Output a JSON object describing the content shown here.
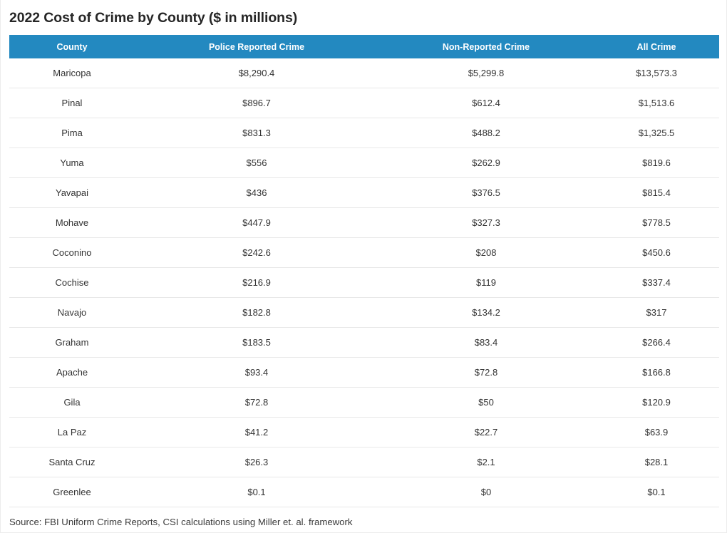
{
  "header": {
    "title": "2022 Cost of Crime by County ($ in millions)"
  },
  "colors": {
    "header_band": "#2389c0",
    "header_text": "#ffffff",
    "title_text": "#262626",
    "cell_text": "#333333",
    "row_divider": "#e8e8e8",
    "page_background": "#ffffff"
  },
  "table": {
    "columns": [
      {
        "key": "county",
        "label": "County",
        "align": "center"
      },
      {
        "key": "police_reported",
        "label": "Police Reported Crime",
        "align": "center"
      },
      {
        "key": "non_reported",
        "label": "Non-Reported Crime",
        "align": "center"
      },
      {
        "key": "all_crime",
        "label": "All Crime",
        "align": "center"
      }
    ],
    "rows": [
      {
        "county": "Maricopa",
        "police_reported": "$8,290.4",
        "non_reported": "$5,299.8",
        "all_crime": "$13,573.3"
      },
      {
        "county": "Pinal",
        "police_reported": "$896.7",
        "non_reported": "$612.4",
        "all_crime": "$1,513.6"
      },
      {
        "county": "Pima",
        "police_reported": "$831.3",
        "non_reported": "$488.2",
        "all_crime": "$1,325.5"
      },
      {
        "county": "Yuma",
        "police_reported": "$556",
        "non_reported": "$262.9",
        "all_crime": "$819.6"
      },
      {
        "county": "Yavapai",
        "police_reported": "$436",
        "non_reported": "$376.5",
        "all_crime": "$815.4"
      },
      {
        "county": "Mohave",
        "police_reported": "$447.9",
        "non_reported": "$327.3",
        "all_crime": "$778.5"
      },
      {
        "county": "Coconino",
        "police_reported": "$242.6",
        "non_reported": "$208",
        "all_crime": "$450.6"
      },
      {
        "county": "Cochise",
        "police_reported": "$216.9",
        "non_reported": "$119",
        "all_crime": "$337.4"
      },
      {
        "county": "Navajo",
        "police_reported": "$182.8",
        "non_reported": "$134.2",
        "all_crime": "$317"
      },
      {
        "county": "Graham",
        "police_reported": "$183.5",
        "non_reported": "$83.4",
        "all_crime": "$266.4"
      },
      {
        "county": "Apache",
        "police_reported": "$93.4",
        "non_reported": "$72.8",
        "all_crime": "$166.8"
      },
      {
        "county": "Gila",
        "police_reported": "$72.8",
        "non_reported": "$50",
        "all_crime": "$120.9"
      },
      {
        "county": "La Paz",
        "police_reported": "$41.2",
        "non_reported": "$22.7",
        "all_crime": "$63.9"
      },
      {
        "county": "Santa Cruz",
        "police_reported": "$26.3",
        "non_reported": "$2.1",
        "all_crime": "$28.1"
      },
      {
        "county": "Greenlee",
        "police_reported": "$0.1",
        "non_reported": "$0",
        "all_crime": "$0.1"
      }
    ]
  },
  "footer": {
    "source": "Source: FBI Uniform Crime Reports, CSI calculations using Miller et. al. framework"
  },
  "chart_data": {
    "type": "table",
    "title": "2022 Cost of Crime by County ($ in millions)",
    "units": "millions of US dollars",
    "categories": [
      "Maricopa",
      "Pinal",
      "Pima",
      "Yuma",
      "Yavapai",
      "Mohave",
      "Coconino",
      "Cochise",
      "Navajo",
      "Graham",
      "Apache",
      "Gila",
      "La Paz",
      "Santa Cruz",
      "Greenlee"
    ],
    "series": [
      {
        "name": "Police Reported Crime",
        "values": [
          8290.4,
          896.7,
          831.3,
          556,
          436,
          447.9,
          242.6,
          216.9,
          182.8,
          183.5,
          93.4,
          72.8,
          41.2,
          26.3,
          0.1
        ]
      },
      {
        "name": "Non-Reported Crime",
        "values": [
          5299.8,
          612.4,
          488.2,
          262.9,
          376.5,
          327.3,
          208,
          119,
          134.2,
          83.4,
          72.8,
          50,
          22.7,
          2.1,
          0
        ]
      },
      {
        "name": "All Crime",
        "values": [
          13573.3,
          1513.6,
          1325.5,
          819.6,
          815.4,
          778.5,
          450.6,
          337.4,
          317,
          266.4,
          166.8,
          120.9,
          63.9,
          28.1,
          0.1
        ]
      }
    ],
    "xlabel": "County",
    "ylabel": "Cost ($ in millions)",
    "grid": false,
    "legend": "none",
    "annotations": [
      "Source: FBI Uniform Crime Reports, CSI calculations using Miller et. al. framework"
    ]
  }
}
